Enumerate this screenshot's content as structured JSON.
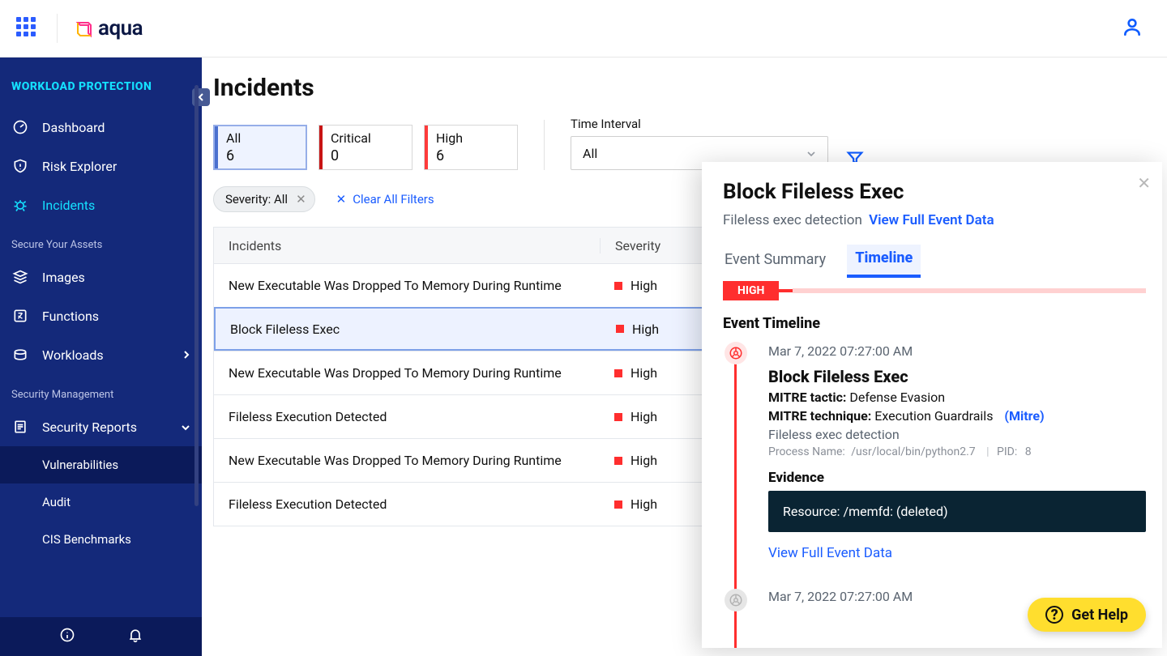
{
  "header": {
    "brand": "aqua"
  },
  "sidebar": {
    "section": "WORKLOAD PROTECTION",
    "items": [
      {
        "label": "Dashboard",
        "active": false
      },
      {
        "label": "Risk Explorer",
        "active": false
      },
      {
        "label": "Incidents",
        "active": true
      }
    ],
    "group_assets_label": "Secure Your Assets",
    "assets": [
      {
        "label": "Images"
      },
      {
        "label": "Functions"
      },
      {
        "label": "Workloads",
        "has_chevron": true
      }
    ],
    "group_mgmt_label": "Security Management",
    "mgmt": {
      "label": "Security Reports",
      "children": [
        {
          "label": "Vulnerabilities"
        },
        {
          "label": "Audit"
        },
        {
          "label": "CIS Benchmarks"
        }
      ]
    }
  },
  "page": {
    "title": "Incidents",
    "sev_cards": {
      "all": {
        "label": "All",
        "count": "6"
      },
      "critical": {
        "label": "Critical",
        "count": "0"
      },
      "high": {
        "label": "High",
        "count": "6"
      }
    },
    "time_interval": {
      "label": "Time Interval",
      "value": "All"
    },
    "filter_chip": "Severity: All",
    "clear_all": "Clear All Filters",
    "table": {
      "headers": {
        "incidents": "Incidents",
        "severity": "Severity"
      },
      "rows": [
        {
          "name": "New Executable Was Dropped To Memory During Runtime",
          "sev": "High"
        },
        {
          "name": "Block Fileless Exec",
          "sev": "High",
          "selected": true
        },
        {
          "name": "New Executable Was Dropped To Memory During Runtime",
          "sev": "High"
        },
        {
          "name": "Fileless Execution Detected",
          "sev": "High"
        },
        {
          "name": "New Executable Was Dropped To Memory During Runtime",
          "sev": "High"
        },
        {
          "name": "Fileless Execution Detected",
          "sev": "High"
        }
      ]
    }
  },
  "panel": {
    "title": "Block Fileless Exec",
    "subtitle": "Fileless exec detection",
    "view_full": "View Full Event Data",
    "tabs": {
      "summary": "Event Summary",
      "timeline": "Timeline"
    },
    "sev_badge": "HIGH",
    "timeline_title": "Event Timeline",
    "event": {
      "time": "Mar 7, 2022 07:27:00 AM",
      "name": "Block Fileless Exec",
      "tactic_label": "MITRE tactic:",
      "tactic_value": "Defense Evasion",
      "technique_label": "MITRE technique:",
      "technique_value": "Execution Guardrails",
      "mitre_link": "(Mitre)",
      "desc": "Fileless exec detection",
      "process_label": "Process Name:",
      "process_value": "/usr/local/bin/python2.7",
      "pid_label": "PID:",
      "pid_value": "8",
      "evidence_label": "Evidence",
      "evidence_text": "Resource: /memfd: (deleted)",
      "view_full": "View Full Event Data"
    },
    "event2_time": "Mar 7, 2022 07:27:00 AM"
  },
  "help": {
    "label": "Get Help"
  }
}
